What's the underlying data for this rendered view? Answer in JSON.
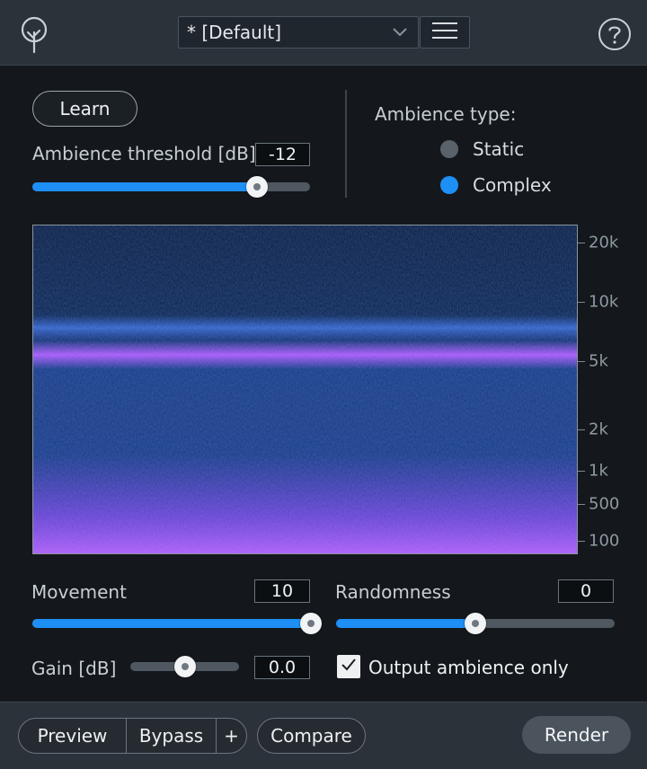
{
  "header": {
    "logo_icon": "tree-logo-icon",
    "preset_name": "* [Default]",
    "menu_icon": "hamburger-icon",
    "help_icon": "help-icon"
  },
  "controls": {
    "learn_label": "Learn",
    "threshold_label": "Ambience threshold [dB]",
    "threshold_value": "-12",
    "threshold_slider_fraction": 0.81,
    "ambience_type_label": "Ambience type:",
    "ambience_options": [
      {
        "label": "Static",
        "selected": false
      },
      {
        "label": "Complex",
        "selected": true
      }
    ]
  },
  "spectrogram": {
    "freq_labels": [
      "20k",
      "10k",
      "5k",
      "2k",
      "1k",
      "500",
      "100"
    ]
  },
  "params": {
    "movement_label": "Movement",
    "movement_value": "10",
    "movement_fraction": 1.0,
    "randomness_label": "Randomness",
    "randomness_value": "0",
    "randomness_fraction": 0.5,
    "gain_label": "Gain [dB]",
    "gain_value": "0.0",
    "gain_fraction": 0.5,
    "output_ambience_label": "Output ambience only",
    "output_ambience_checked": true
  },
  "footer": {
    "preview_label": "Preview",
    "bypass_label": "Bypass",
    "plus_label": "+",
    "compare_label": "Compare",
    "render_label": "Render"
  },
  "colors": {
    "accent_blue": "#1e8ff5",
    "radio_off": "#59626b",
    "spectro_purple": "#b45cff"
  }
}
